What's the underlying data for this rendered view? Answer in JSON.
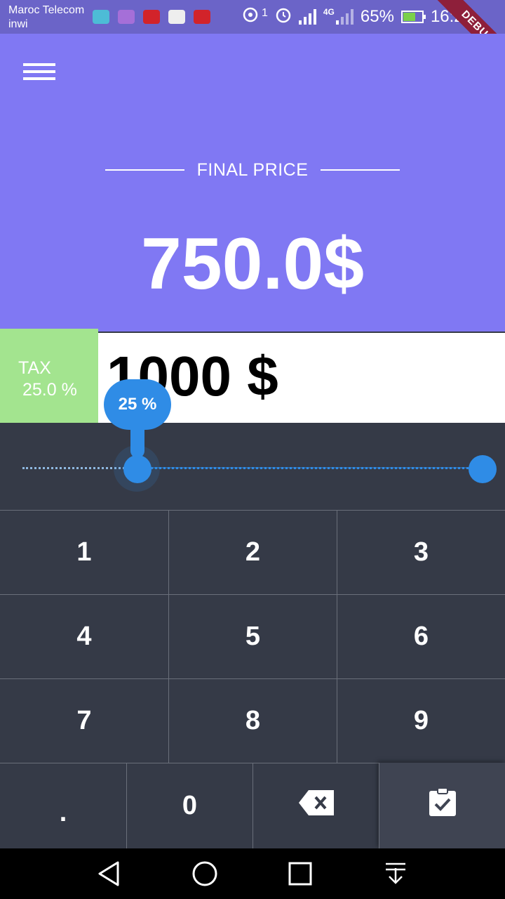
{
  "status_bar": {
    "carrier_1": "Maroc Telecom",
    "carrier_2": "inwi",
    "sim_index": "1",
    "network": "4G",
    "battery": "65%",
    "time": "16:21"
  },
  "debug_banner": "DEBUG",
  "header": {
    "final_label": "FINAL PRICE",
    "final_price": "750.0$"
  },
  "tax": {
    "label": "TAX",
    "value": "25.0 %"
  },
  "amount": "1000 $",
  "slider": {
    "bubble_label": "25 %",
    "value_fraction": 0.25
  },
  "keypad": {
    "keys": [
      "1",
      "2",
      "3",
      "4",
      "5",
      "6",
      "7",
      "8",
      "9",
      ".",
      "0"
    ]
  },
  "colors": {
    "header": "#8078f3",
    "tax": "#a3e48f",
    "accent": "#2f8ce6",
    "keypad": "#353a47"
  }
}
